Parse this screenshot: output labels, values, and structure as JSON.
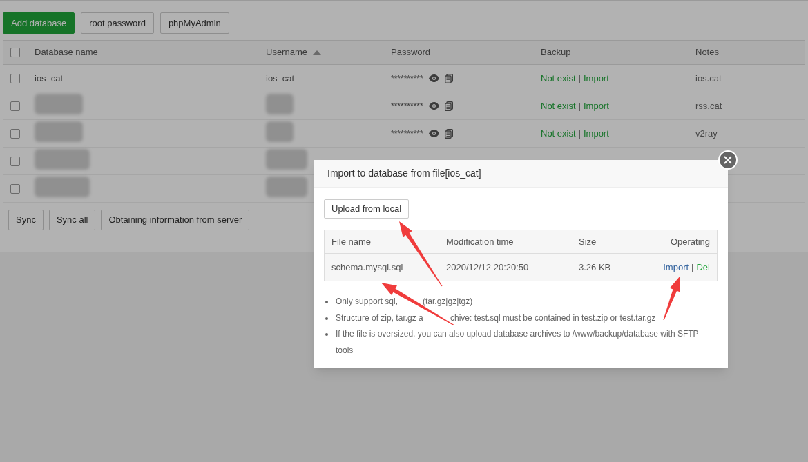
{
  "toolbar": [
    "Add database",
    "root password",
    "phpMyAdmin"
  ],
  "table": {
    "select_all_checked": false,
    "columns": [
      {
        "label": "Database name",
        "sorted": false
      },
      {
        "label": "Username",
        "sorted": true
      },
      {
        "label": "Password",
        "sorted": false
      },
      {
        "label": "Backup",
        "sorted": false
      },
      {
        "label": "Notes",
        "sorted": false
      }
    ],
    "rows": [
      {
        "kind": "entry",
        "checked": false,
        "name": "ios_cat",
        "username": "ios_cat",
        "password": "**********",
        "backup_status": "Not exist",
        "separator": "|",
        "backup_action": "Import",
        "notes": "ios.cat"
      },
      {
        "kind": "redacted",
        "checked": false,
        "password": "**********",
        "backup_status": "Not exist",
        "separator": "|",
        "backup_action": "Import",
        "notes": "rss.cat"
      },
      {
        "kind": "redacted",
        "checked": false,
        "password": "**********",
        "backup_status": "Not exist",
        "separator": "|",
        "backup_action": "Import",
        "notes": "v2ray"
      },
      {
        "kind": "covered",
        "checked": false
      },
      {
        "kind": "covered",
        "checked": false
      }
    ]
  },
  "footer_buttons": [
    "Sync",
    "Sync all",
    "Obtaining information from server"
  ],
  "dialog": {
    "title": "Import to database from file[ios_cat]",
    "upload_button": "Upload from local",
    "columns": [
      "File name",
      "Modification time",
      "Size",
      "Operating"
    ],
    "files": [
      {
        "name": "schema.mysql.sql",
        "time": "2020/12/12 20:20:50",
        "size": "3.26 KB",
        "import": "Import",
        "separator": "|",
        "delete": "Del"
      }
    ],
    "notes": [
      {
        "parts": [
          "Only support sql,",
          "(tar.gz|gz|tgz)"
        ]
      },
      {
        "parts": [
          "Structure of zip, tar.gz a",
          "chive: test.sql must be contained in test.zip or test.tar.gz"
        ]
      },
      {
        "parts": [
          "If the file is oversized, you can also upload database archives to /www/backup/database with SFTP tools"
        ]
      }
    ]
  }
}
